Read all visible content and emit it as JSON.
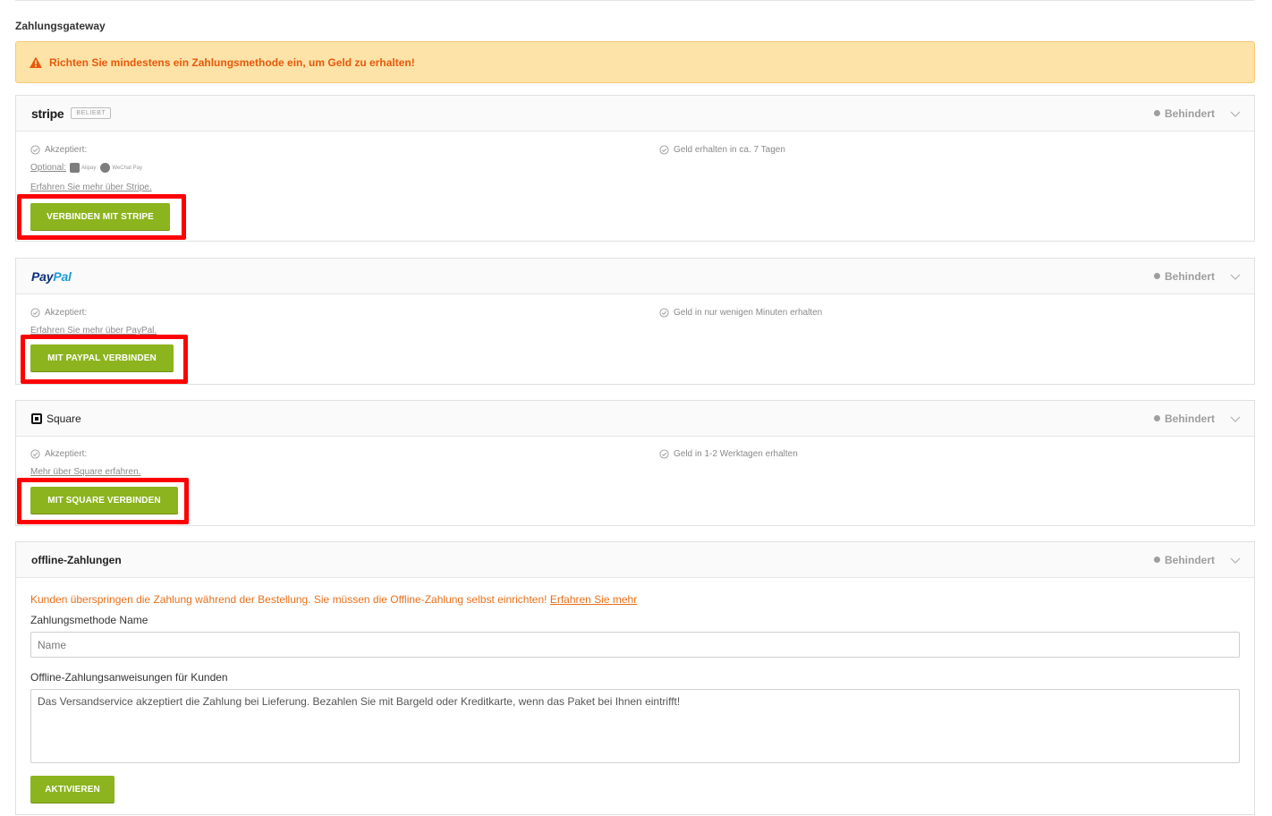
{
  "section_title": "Zahlungsgateway",
  "alert": {
    "text": "Richten Sie mindestens ein Zahlungsmethode ein, um Geld zu erhalten!",
    "color": "#e8590c",
    "background": "#fde3a7"
  },
  "colors": {
    "accent_button": "#8cb41e",
    "highlight": "#ff0000",
    "status_gray": "#9e9e9e"
  },
  "stripe": {
    "logo": "stripe",
    "badge": "BELIEBT",
    "status": "Behindert",
    "accepted": "Akzeptiert:",
    "optional": "Optional:",
    "optional_methods": [
      "Alipay",
      "WeChat Pay"
    ],
    "payout": "Geld erhalten in ca. 7 Tagen",
    "learn_more": "Erfahren Sie mehr über Stripe.",
    "button": "VERBINDEN MIT STRIPE"
  },
  "paypal": {
    "logo_pay": "Pay",
    "logo_pal": "Pal",
    "status": "Behindert",
    "accepted": "Akzeptiert:",
    "payout": "Geld in nur wenigen Minuten erhalten",
    "learn_more": "Erfahren Sie mehr über PayPal.",
    "button": "MIT PAYPAL VERBINDEN"
  },
  "square": {
    "name": "Square",
    "status": "Behindert",
    "accepted": "Akzeptiert:",
    "payout": "Geld in 1-2 Werktagen erhalten",
    "learn_more": "Mehr über Square erfahren.",
    "button": "MIT SQUARE VERBINDEN"
  },
  "offline": {
    "title": "offline-Zahlungen",
    "status": "Behindert",
    "notice": "Kunden überspringen die Zahlung während der Bestellung. Sie müssen die Offline-Zahlung selbst einrichten!",
    "notice_link": "Erfahren Sie mehr",
    "name_label": "Zahlungsmethode Name",
    "name_placeholder": "Name",
    "instructions_label": "Offline-Zahlungsanweisungen für Kunden",
    "instructions_value": "Das Versandservice akzeptiert die Zahlung bei Lieferung. Bezahlen Sie mit Bargeld oder Kreditkarte, wenn das Paket bei Ihnen eintrifft!",
    "button": "AKTIVIEREN"
  },
  "icons": [
    "warning-icon",
    "check-circle-icon",
    "chevron-down-icon",
    "alipay-icon",
    "wechat-pay-icon",
    "square-logo-icon"
  ]
}
